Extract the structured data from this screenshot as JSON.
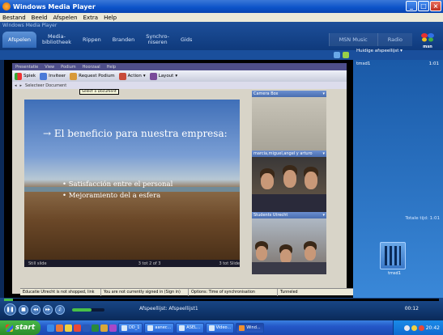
{
  "window": {
    "title": "Windows Media Player"
  },
  "menubar": [
    "Bestand",
    "Beeld",
    "Afspelen",
    "Extra",
    "Help"
  ],
  "wmp": {
    "logo_text": "Windows Media Player",
    "tabs": [
      "Afspelen",
      "Media-\nbibliotheek",
      "Rippen",
      "Branden",
      "Synchro-\nniseren",
      "Gids"
    ],
    "tabs_right": [
      "MSN Music",
      "Radio"
    ],
    "msn_label": "msn"
  },
  "inner_app": {
    "menu": [
      "Presentatie",
      "View",
      "Podium",
      "Hoorzaal",
      "Help"
    ],
    "toolbar": [
      "Spiek",
      "Inviteer",
      "Request Podium",
      "Action",
      "Layout"
    ],
    "toolbar2": "Selecteer Document",
    "tooltip": "Select a Document"
  },
  "slide": {
    "title": "→ El beneficio para nuestra empresa:",
    "bullets": [
      "Satisfacción entre el personal",
      "Mejoramiento del a esfera"
    ],
    "status": [
      "Still slide",
      "3 tot 2 of 3",
      "3 tot Slide"
    ]
  },
  "cams": [
    {
      "label": "Camera Box"
    },
    {
      "label": "marcia,miguel,angel y arturo"
    },
    {
      "label": "Students  Utrecht"
    }
  ],
  "inner_status": [
    "Educatie Utrecht is not shopped, link",
    "You are not currently signed in (Sign in)",
    "Options: Time of synchronisation",
    "Tunneled"
  ],
  "right_panel": {
    "playlist_label": "Huidige afspeellijst",
    "item_name": "tmsd1",
    "item_time": "1:01",
    "total": "Totale tijd: 1:01",
    "thumb_label": "tmsd1"
  },
  "player": {
    "now_playing": "Afspeellijst: Afspeellijst1",
    "time": "00:12",
    "seek_fraction": 0.02,
    "volume_fraction": 0.6
  },
  "taskbar": {
    "start": "start",
    "tasks": [
      "DD_1",
      "aanec...",
      "ASEL...",
      "Video...",
      "Wind..."
    ],
    "clock": "20:42"
  },
  "colors": {
    "xp_blue": "#0b52c8",
    "wmp_blue": "#1d4f9a",
    "start_green": "#48b848"
  }
}
